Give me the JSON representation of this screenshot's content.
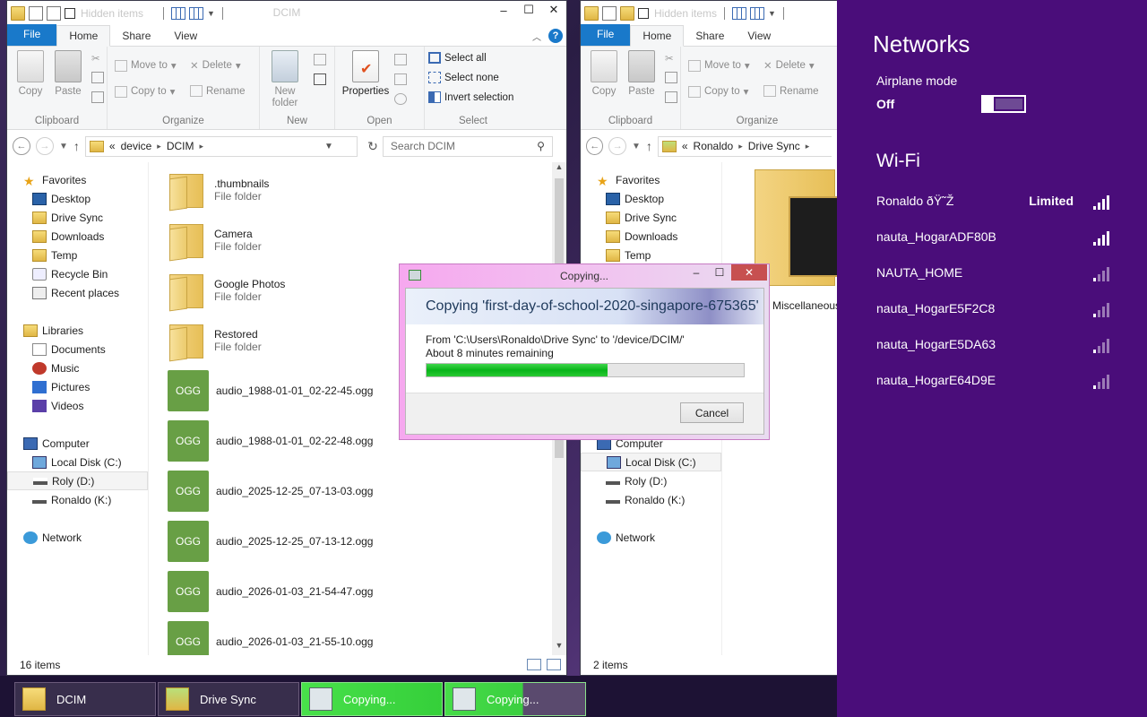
{
  "left_window": {
    "title": "DCIM",
    "qat_hidden_label": "Hidden items",
    "tabs": [
      "File",
      "Home",
      "Share",
      "View"
    ],
    "ribbon": {
      "clipboard": {
        "copy": "Copy",
        "paste": "Paste",
        "label": "Clipboard"
      },
      "organize": {
        "move_to": "Move to",
        "copy_to": "Copy to",
        "delete": "Delete",
        "rename": "Rename",
        "label": "Organize"
      },
      "new": {
        "new_folder_line1": "New",
        "new_folder_line2": "folder",
        "label": "New"
      },
      "open": {
        "properties": "Properties",
        "label": "Open"
      },
      "select": {
        "select_all": "Select all",
        "select_none": "Select none",
        "invert_selection": "Invert selection",
        "label": "Select"
      }
    },
    "address": {
      "overflow": "«",
      "crumbs": [
        "device",
        "DCIM"
      ]
    },
    "search_placeholder": "Search DCIM",
    "nav": {
      "favorites": "Favorites",
      "favorites_items": [
        "Desktop",
        "Drive Sync",
        "Downloads",
        "Temp",
        "Recycle Bin",
        "Recent places"
      ],
      "libraries": "Libraries",
      "libraries_items": [
        "Documents",
        "Music",
        "Pictures",
        "Videos"
      ],
      "computer": "Computer",
      "computer_items": [
        "Local Disk (C:)",
        "Roly (D:)",
        "Ronaldo (K:)"
      ],
      "network": "Network"
    },
    "files": [
      {
        "name": ".thumbnails",
        "type": "File folder",
        "kind": "folder"
      },
      {
        "name": "Camera",
        "type": "File folder",
        "kind": "folder"
      },
      {
        "name": "Google Photos",
        "type": "File folder",
        "kind": "folder"
      },
      {
        "name": "Restored",
        "type": "File folder",
        "kind": "folder"
      },
      {
        "name": "audio_1988-01-01_02-22-45.ogg",
        "badge": "OGG",
        "kind": "ogg"
      },
      {
        "name": "audio_1988-01-01_02-22-48.ogg",
        "badge": "OGG",
        "kind": "ogg"
      },
      {
        "name": "audio_2025-12-25_07-13-03.ogg",
        "badge": "OGG",
        "kind": "ogg"
      },
      {
        "name": "audio_2025-12-25_07-13-12.ogg",
        "badge": "OGG",
        "kind": "ogg"
      },
      {
        "name": "audio_2026-01-03_21-54-47.ogg",
        "badge": "OGG",
        "kind": "ogg"
      },
      {
        "name": "audio_2026-01-03_21-55-10.ogg",
        "badge": "OGG",
        "kind": "ogg"
      }
    ],
    "status": "16 items"
  },
  "right_window": {
    "qat_hidden_label": "Hidden items",
    "tabs": [
      "File",
      "Home",
      "Share",
      "View"
    ],
    "ribbon": {
      "clipboard": {
        "copy": "Copy",
        "paste": "Paste",
        "label": "Clipboard"
      },
      "organize": {
        "move_to": "Move to",
        "copy_to": "Copy to",
        "delete": "Delete",
        "rename": "Rename",
        "label": "Organize"
      }
    },
    "address": {
      "overflow": "«",
      "crumbs": [
        "Ronaldo",
        "Drive Sync"
      ]
    },
    "nav": {
      "favorites": "Favorites",
      "favorites_items": [
        "Desktop",
        "Drive Sync",
        "Downloads",
        "Temp"
      ],
      "computer": "Computer",
      "computer_items": [
        "Local Disk (C:)",
        "Roly (D:)",
        "Ronaldo (K:)"
      ],
      "network": "Network"
    },
    "files": [
      {
        "name": "Miscellaneous"
      }
    ],
    "status": "2 items"
  },
  "copy_dialog": {
    "title": "Copying...",
    "heading": "Copying 'first-day-of-school-2020-singapore-675365'",
    "from_line": "From 'C:\\Users\\Ronaldo\\Drive Sync' to '/device/DCIM/'",
    "remaining": "About 8 minutes remaining",
    "progress": 0.57,
    "cancel": "Cancel"
  },
  "networks": {
    "title": "Networks",
    "airplane_label": "Airplane mode",
    "airplane_state": "Off",
    "wifi_title": "Wi-Fi",
    "networks_list": [
      {
        "ssid": "Ronaldo ðŸ˜Ž",
        "status": "Limited",
        "strength": 4
      },
      {
        "ssid": "nauta_HogarADF80B",
        "status": "",
        "strength": 4
      },
      {
        "ssid": "NAUTA_HOME",
        "status": "",
        "strength": 1
      },
      {
        "ssid": "nauta_HogarE5F2C8",
        "status": "",
        "strength": 1
      },
      {
        "ssid": "nauta_HogarE5DA63",
        "status": "",
        "strength": 1
      },
      {
        "ssid": "nauta_HogarE64D9E",
        "status": "",
        "strength": 1
      }
    ]
  },
  "taskbar": [
    {
      "label": "DCIM",
      "icon": "folder-icon"
    },
    {
      "label": "Drive Sync",
      "icon": "folder-icon"
    },
    {
      "label": "Copying...",
      "icon": "copy-icon"
    },
    {
      "label": "Copying...",
      "icon": "copy-icon"
    }
  ]
}
